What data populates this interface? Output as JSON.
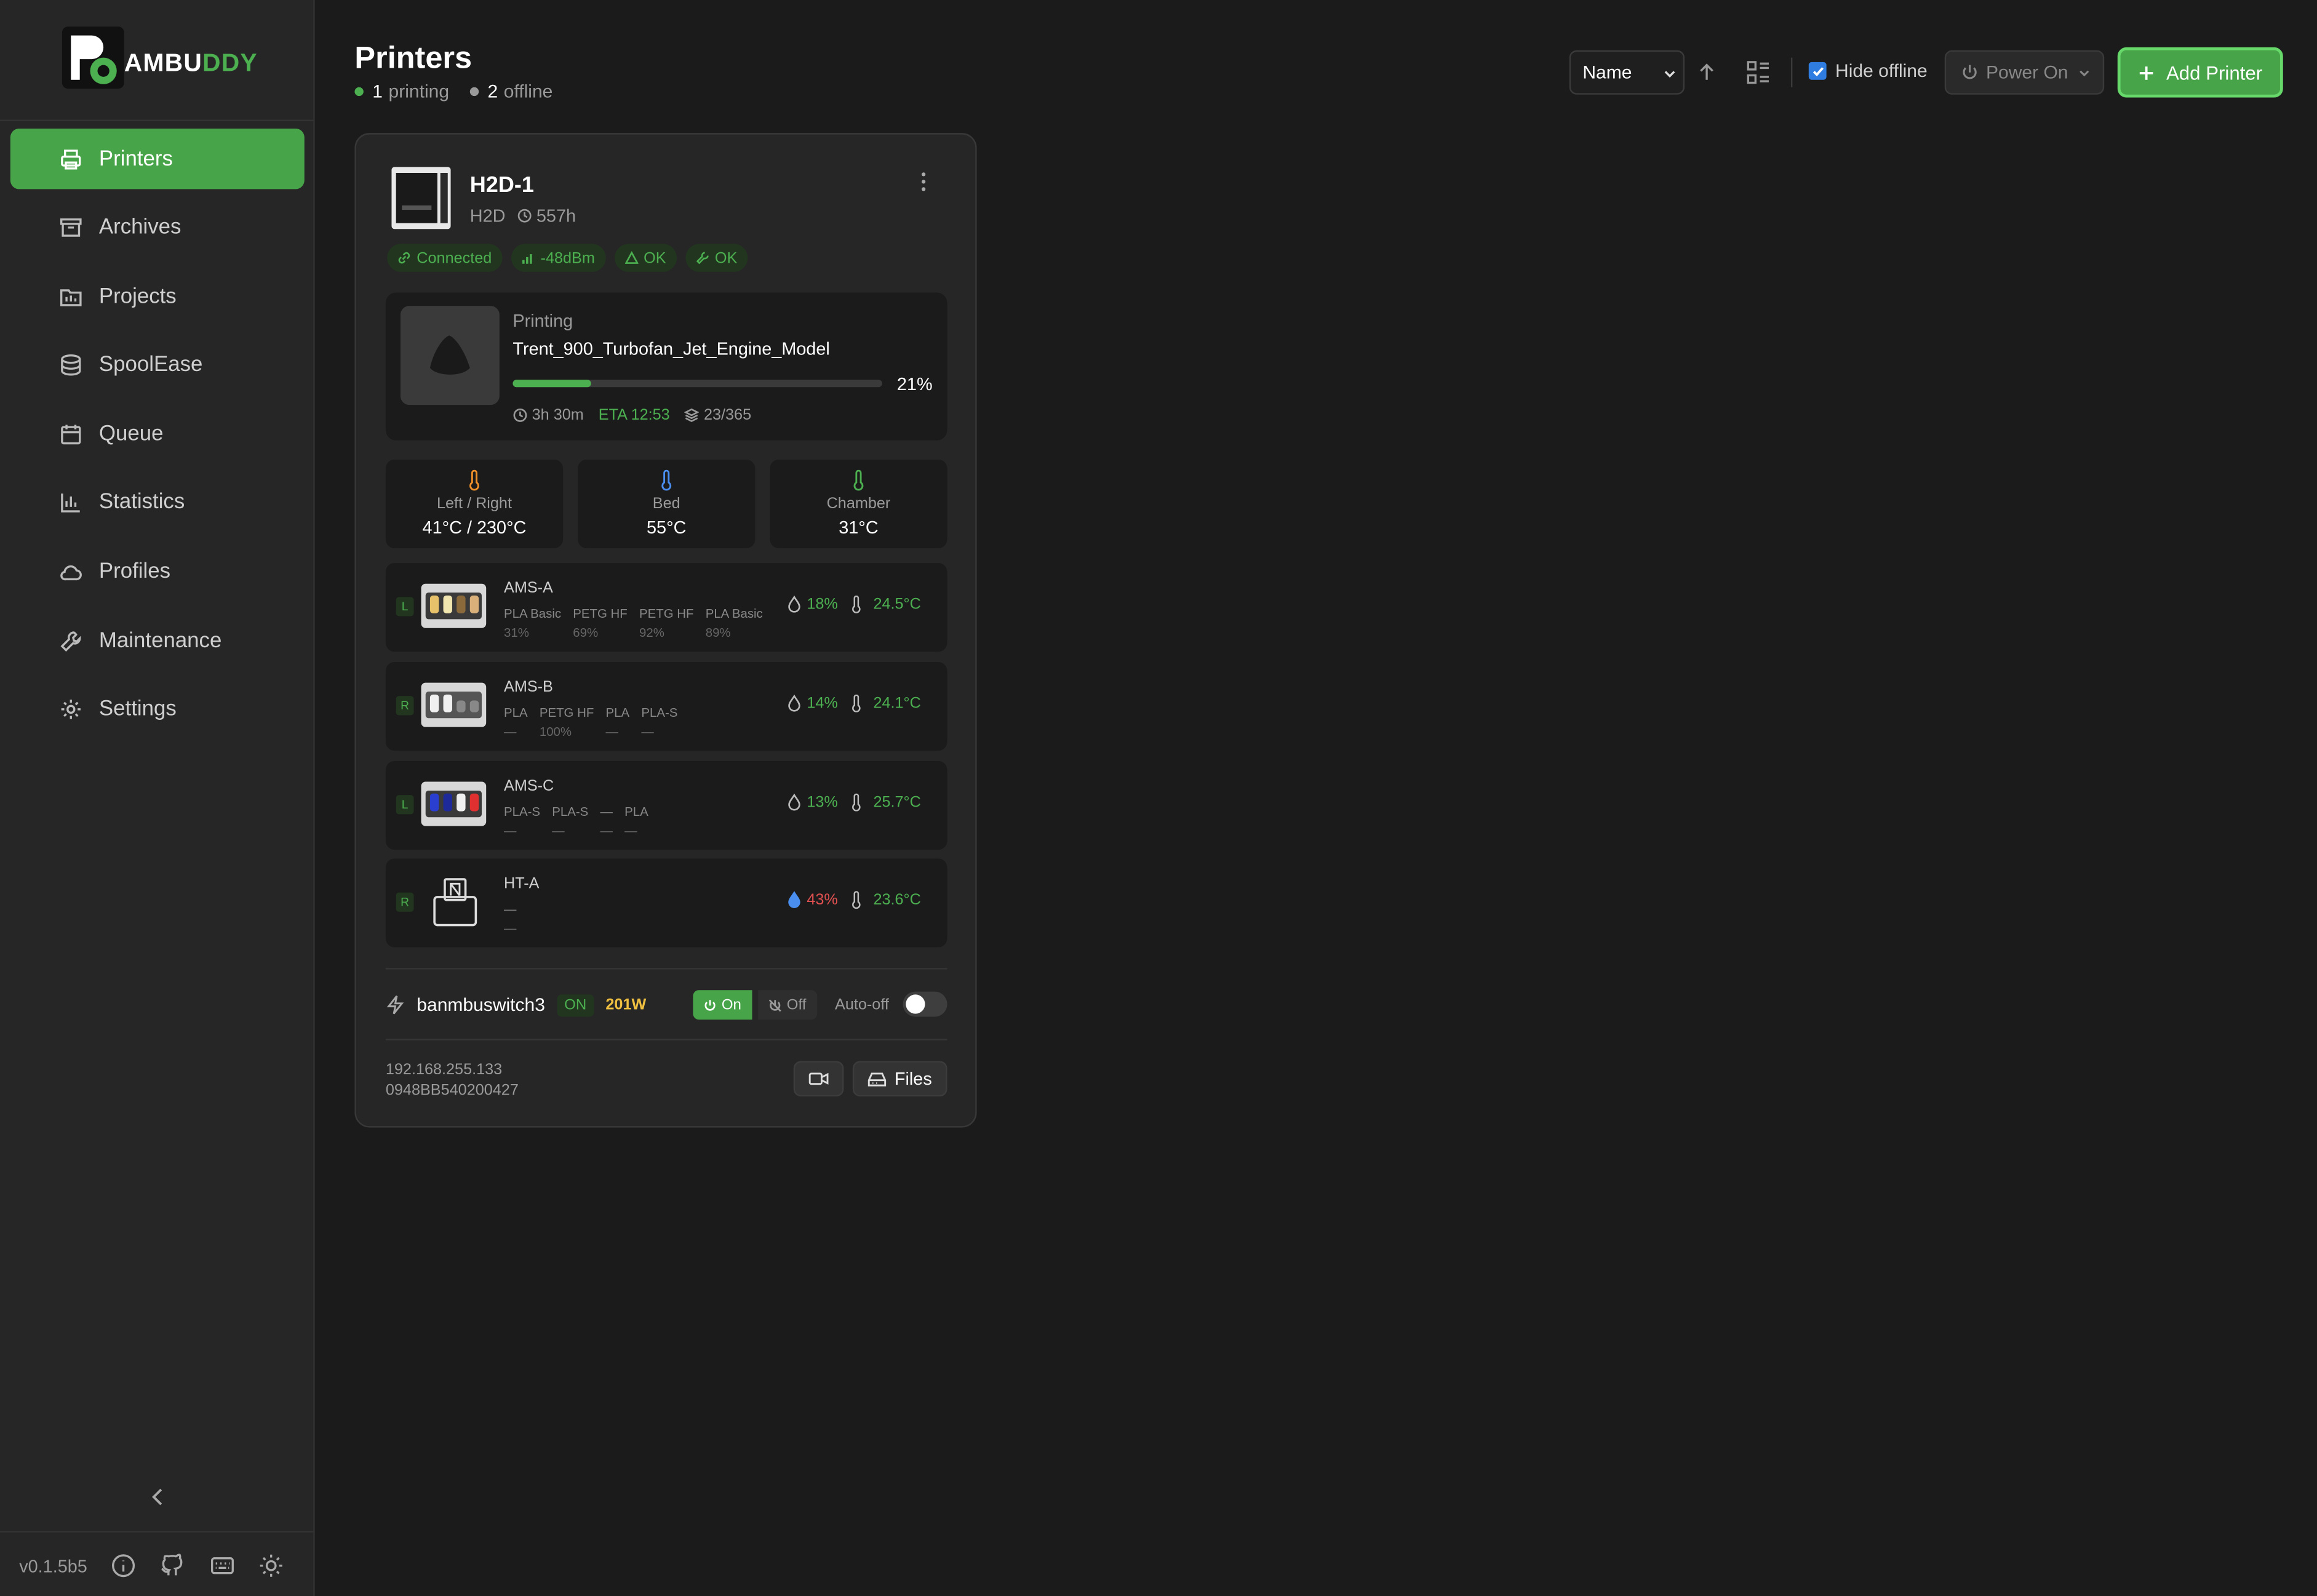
{
  "brand": {
    "name_prefix": "AMBU",
    "name_suffix": "DDY",
    "accent": "#47a448"
  },
  "sidebar": {
    "items": [
      {
        "label": "Printers",
        "icon": "printer-icon",
        "active": true
      },
      {
        "label": "Archives",
        "icon": "archive-icon"
      },
      {
        "label": "Projects",
        "icon": "projects-icon"
      },
      {
        "label": "SpoolEase",
        "icon": "spool-icon"
      },
      {
        "label": "Queue",
        "icon": "calendar-icon"
      },
      {
        "label": "Statistics",
        "icon": "bar-chart-icon"
      },
      {
        "label": "Profiles",
        "icon": "cloud-icon"
      },
      {
        "label": "Maintenance",
        "icon": "wrench-icon"
      },
      {
        "label": "Settings",
        "icon": "gear-icon"
      }
    ],
    "version": "v0.1.5b5"
  },
  "header": {
    "title": "Printers",
    "printing_count": "1",
    "printing_label": "printing",
    "offline_count": "2",
    "offline_label": "offline"
  },
  "toolbar": {
    "sort_value": "Name",
    "hide_offline_label": "Hide offline",
    "hide_offline_checked": true,
    "power_on_label": "Power On",
    "add_printer_label": "Add Printer"
  },
  "printer": {
    "name": "H2D-1",
    "model": "H2D",
    "hours": "557h",
    "badges": {
      "connected": "Connected",
      "signal": "-48dBm",
      "hms": "OK",
      "maintenance": "OK"
    },
    "job": {
      "status": "Printing",
      "filename": "Trent_900_Turbofan_Jet_Engine_Model",
      "progress": 21,
      "progress_label": "21%",
      "remaining": "3h 30m",
      "eta": "ETA 12:53",
      "layers": "23/365"
    },
    "temps": [
      {
        "label": "Left / Right",
        "value": "41°C / 230°C",
        "color": "#f0902a"
      },
      {
        "label": "Bed",
        "value": "55°C",
        "color": "#4a8ef0"
      },
      {
        "label": "Chamber",
        "value": "31°C",
        "color": "#4caf50"
      }
    ],
    "ams": [
      {
        "tag": "L",
        "name": "AMS-A",
        "humidity": "18%",
        "temp": "24.5°C",
        "slots": [
          {
            "type": "PLA Basic",
            "pct": "31%"
          },
          {
            "type": "PETG HF",
            "pct": "69%"
          },
          {
            "type": "PETG HF",
            "pct": "92%"
          },
          {
            "type": "PLA Basic",
            "pct": "89%"
          }
        ],
        "colors": [
          "#e8c26a",
          "#f2e6b0",
          "#8a6a3a",
          "#d9b07a"
        ]
      },
      {
        "tag": "R",
        "name": "AMS-B",
        "humidity": "14%",
        "temp": "24.1°C",
        "slots": [
          {
            "type": "PLA",
            "pct": "—"
          },
          {
            "type": "PETG HF",
            "pct": "100%"
          },
          {
            "type": "PLA",
            "pct": "—"
          },
          {
            "type": "PLA-S",
            "pct": "—"
          }
        ],
        "colors": [
          "#f0f0f0",
          "#f0f0f0",
          "#888888",
          "#888888"
        ]
      },
      {
        "tag": "L",
        "name": "AMS-C",
        "humidity": "13%",
        "temp": "25.7°C",
        "slots": [
          {
            "type": "PLA-S",
            "pct": "—"
          },
          {
            "type": "PLA-S",
            "pct": "—"
          },
          {
            "type": "—",
            "pct": "—"
          },
          {
            "type": "PLA",
            "pct": "—"
          }
        ],
        "colors": [
          "#2a3fd0",
          "#1e2a9a",
          "#f0f0f0",
          "#e03030"
        ]
      },
      {
        "tag": "R",
        "name": "HT-A",
        "humidity": "43%",
        "temp": "23.6°C",
        "humidity_color": "#e05050",
        "slots": [
          {
            "type": "—",
            "pct": "—"
          }
        ],
        "colors": []
      }
    ],
    "plug": {
      "name": "banmbuswitch3",
      "state": "ON",
      "watts": "201W",
      "on_label": "On",
      "off_label": "Off",
      "auto_off_label": "Auto-off"
    },
    "ip": "192.168.255.133",
    "serial": "0948BB540200427",
    "files_label": "Files"
  }
}
